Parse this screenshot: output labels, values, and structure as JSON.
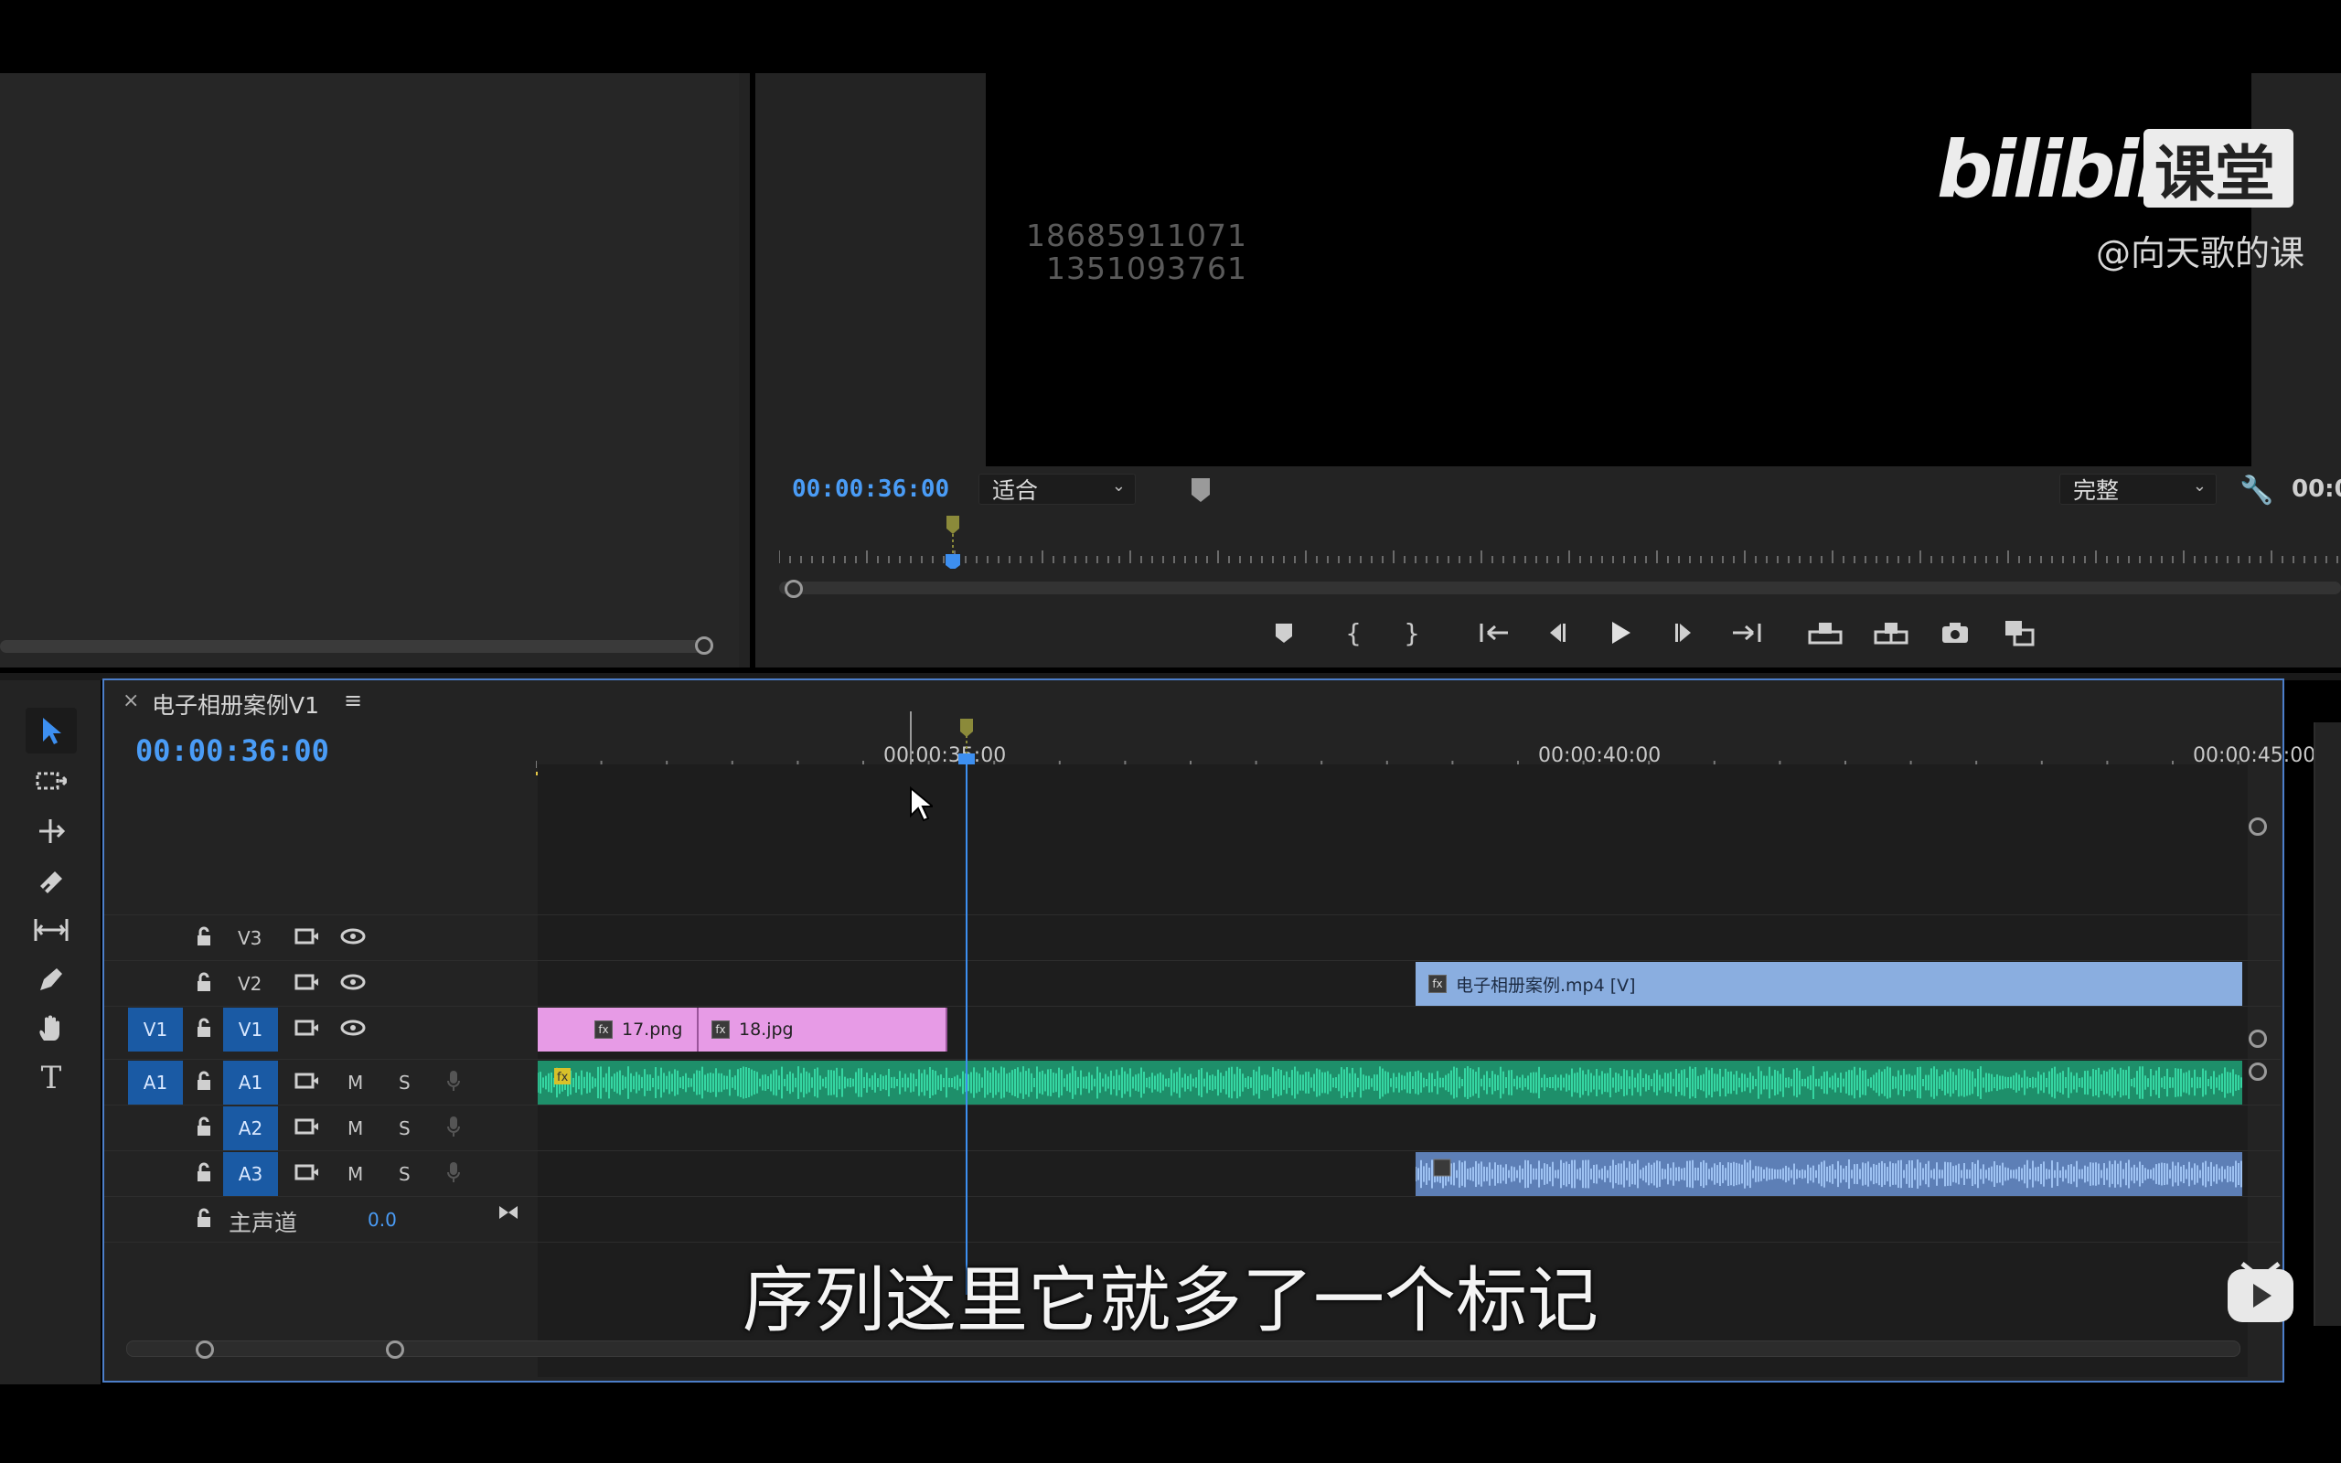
{
  "watermark": {
    "numbers": [
      "18685911071",
      "1351093761"
    ],
    "brand_logo_text": "bilibili 课堂",
    "user": "@向天歌的课"
  },
  "program_monitor": {
    "timecode": "00:00:36:00",
    "fit": "适合",
    "quality": "完整",
    "timecode_right": "00:0"
  },
  "timeline": {
    "sequence_name": "电子相册案例V1",
    "timecode": "00:00:36:00",
    "ruler_labels": [
      "00:00:35:00",
      "00:00:40:00",
      "00:00:45:00"
    ],
    "tracks": {
      "v3": "V3",
      "v2": "V2",
      "v1_source": "V1",
      "v1": "V1",
      "a1_source": "A1",
      "a1": "A1",
      "a2": "A2",
      "a3": "A3",
      "m": "M",
      "s": "S",
      "master": "主声道",
      "master_value": "0.0"
    },
    "clips": {
      "clip_17": "17.png",
      "clip_18": "18.jpg",
      "clip_mp4": "电子相册案例.mp4 [V]"
    }
  },
  "subtitle": "序列这里它就多了一个标记",
  "colors": {
    "accent": "#4a9cf6",
    "pink_clip": "#e79be6",
    "blue_clip": "#8aaee0",
    "audio_green": "#2fbf8f",
    "work_area": "#e5c847"
  }
}
